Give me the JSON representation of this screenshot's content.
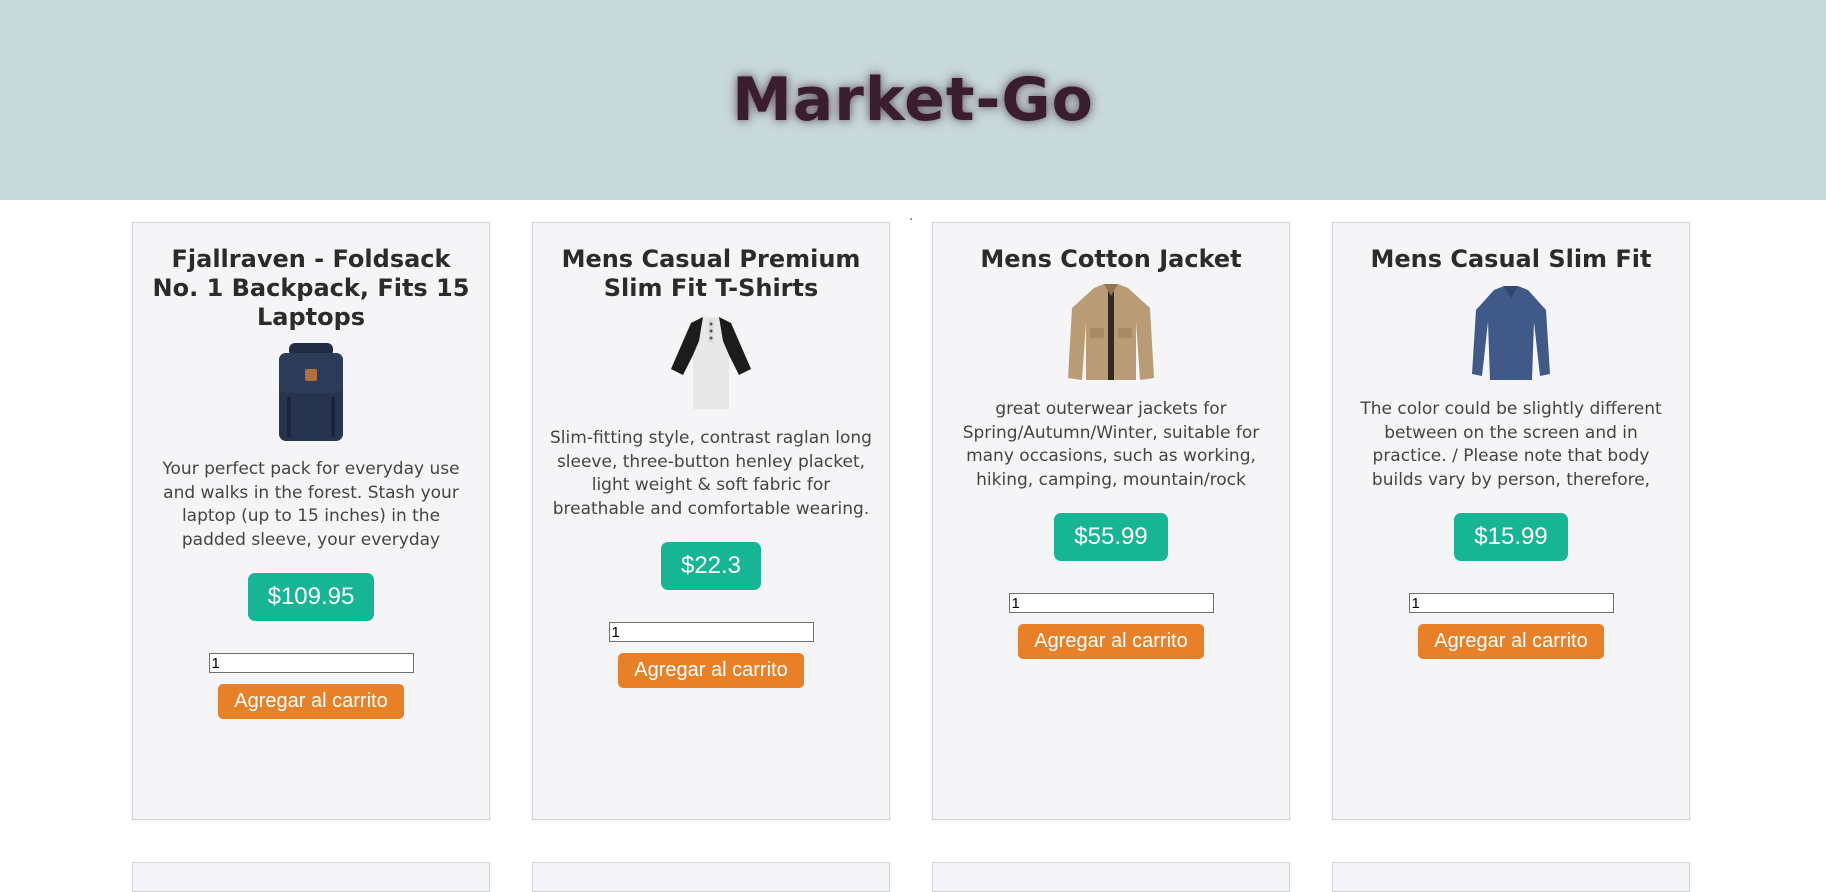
{
  "header": {
    "title": "Market-Go"
  },
  "colors": {
    "header_bg": "#c9dadb",
    "title": "#3a1e2f",
    "price_bg": "#16b695",
    "button_bg": "#e78027",
    "card_bg": "#f5f5f7"
  },
  "products": [
    {
      "title": "Fjallraven - Foldsack No. 1 Backpack, Fits 15 Laptops",
      "image_icon": "backpack-image",
      "description": "Your perfect pack for everyday use and walks in the forest. Stash your laptop (up to 15 inches) in the padded sleeve, your everyday",
      "price": "$109.95",
      "quantity": "1",
      "button_label": "Agregar al carrito"
    },
    {
      "title": "Mens Casual Premium Slim Fit T-Shirts",
      "image_icon": "raglan-shirt-image",
      "description": "Slim-fitting style, contrast raglan long sleeve, three-button henley placket, light weight & soft fabric for breathable and comfortable wearing.",
      "price": "$22.3",
      "quantity": "1",
      "button_label": "Agregar al carrito"
    },
    {
      "title": "Mens Cotton Jacket",
      "image_icon": "jacket-image",
      "description": "great outerwear jackets for Spring/Autumn/Winter, suitable for many occasions, such as working, hiking, camping, mountain/rock",
      "price": "$55.99",
      "quantity": "1",
      "button_label": "Agregar al carrito"
    },
    {
      "title": "Mens Casual Slim Fit",
      "image_icon": "long-sleeve-shirt-image",
      "description": "The color could be slightly different between on the screen and in practice. / Please note that body builds vary by person, therefore,",
      "price": "$15.99",
      "quantity": "1",
      "button_label": "Agregar al carrito"
    }
  ]
}
